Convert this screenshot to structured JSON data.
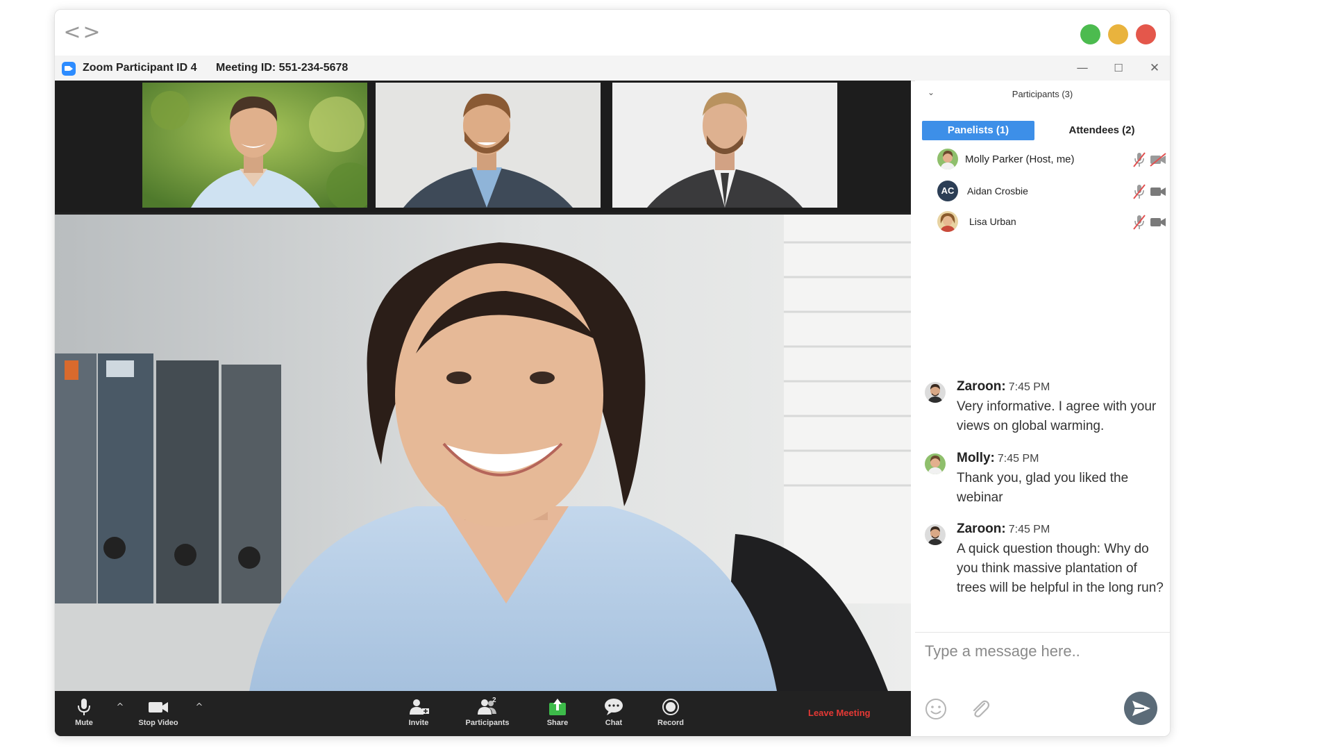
{
  "window": {
    "title_app": "Zoom Participant ID 4",
    "title_meeting": "Meeting ID: 551-234-5678",
    "traffic_lights": [
      "#4cbb4f",
      "#e9b33d",
      "#e4574b"
    ],
    "nav_back": "<",
    "nav_forward": ">",
    "controls": {
      "minimize": "—",
      "maximize": "☐",
      "close": "✕"
    }
  },
  "toolbar": {
    "mute": "Mute",
    "stop_video": "Stop Video",
    "invite": "Invite",
    "participants": "Participants",
    "participants_count": "2",
    "share": "Share",
    "chat": "Chat",
    "record": "Record",
    "leave": "Leave Meeting",
    "caret": "^"
  },
  "participants_panel": {
    "title": "Participants (3)",
    "chevron": "⌄",
    "tabs": [
      {
        "label": "Panelists (1)",
        "active": true
      },
      {
        "label": "Attendees (2)",
        "active": false
      }
    ],
    "list": [
      {
        "name": "Molly Parker (Host, me)",
        "mic": "muted",
        "video": "off"
      },
      {
        "name": "Aidan Crosbie",
        "initials": "AC",
        "mic": "muted",
        "video": "on"
      },
      {
        "name": "Lisa Urban",
        "mic": "muted",
        "video": "on"
      }
    ]
  },
  "chat": {
    "messages": [
      {
        "sender": "Zaroon:",
        "time": "7:45 PM",
        "text": "Very informative. I agree with your views on global warming."
      },
      {
        "sender": "Molly:",
        "time": "7:45 PM",
        "text": "Thank you, glad you liked the webinar"
      },
      {
        "sender": "Zaroon:",
        "time": "7:45 PM",
        "text": "A quick question though: Why do you think massive plantation of trees will be helpful in the long run?"
      }
    ],
    "placeholder": "Type a message here.."
  },
  "colors": {
    "accent": "#3d8fe8",
    "leave": "#e53935",
    "share": "#3dbb4a",
    "muted_red": "#e05050"
  }
}
